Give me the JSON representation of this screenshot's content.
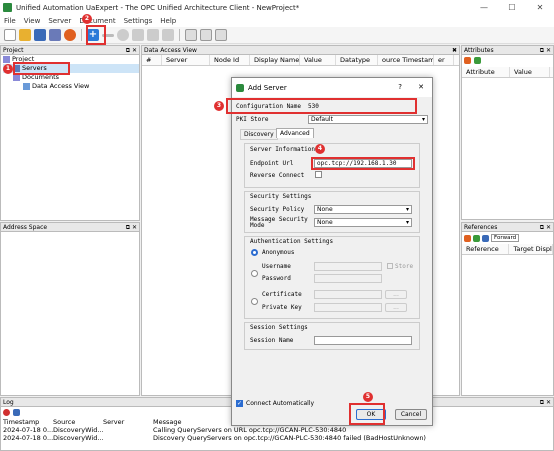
{
  "window": {
    "title": "Unified Automation UaExpert - The OPC Unified Architecture Client - NewProject*",
    "min": "—",
    "max": "☐",
    "close": "✕"
  },
  "menu": [
    "File",
    "View",
    "Server",
    "Document",
    "Settings",
    "Help"
  ],
  "project_panel": {
    "title": "Project",
    "items": [
      "Project",
      "Servers",
      "Documents",
      "Data Access View"
    ]
  },
  "address_panel": {
    "title": "Address Space"
  },
  "dav_panel": {
    "tab": "Data Access View",
    "columns": [
      "#",
      "Server",
      "Node Id",
      "Display Name",
      "Value",
      "Datatype",
      "ource Timestam",
      "er"
    ]
  },
  "attributes_panel": {
    "title": "Attributes",
    "columns": [
      "Attribute",
      "Value"
    ]
  },
  "references_panel": {
    "title": "References",
    "direction": "Forward",
    "columns": [
      "Reference",
      "Target Displa"
    ]
  },
  "log_panel": {
    "title": "Log",
    "columns": [
      "Timestamp",
      "Source",
      "Server",
      "Message"
    ],
    "rows": [
      {
        "ts": "2024-07-18 0...",
        "src": "DiscoveryWid...",
        "srv": "",
        "msg": "Calling QueryServers on URL opc.tcp://GCAN-PLC-530:4840"
      },
      {
        "ts": "2024-07-18 0...",
        "src": "DiscoveryWid...",
        "srv": "",
        "msg": "Discovery QueryServers on opc.tcp://GCAN-PLC-530:4840 failed (BadHostUnknown)"
      }
    ]
  },
  "dialog": {
    "title": "Add Server",
    "help": "?",
    "close": "✕",
    "config_name_label": "Configuration Name",
    "config_name_value": "530",
    "pki_label": "PKI Store",
    "pki_value": "Default",
    "tabs": [
      "Discovery",
      "Advanced"
    ],
    "server_info": "Server Information",
    "endpoint_label": "Endpoint Url",
    "endpoint_value": "opc.tcp://192.168.1.30",
    "reverse_label": "Reverse Connect",
    "security_settings": "Security Settings",
    "policy_label": "Security Policy",
    "policy_value": "None",
    "mode_label": "Message Security Mode",
    "mode_value": "None",
    "auth_settings": "Authentication Settings",
    "anon_label": "Anonymous",
    "user_label": "Username",
    "pass_label": "Password",
    "store_label": "Store",
    "cert_label": "Certificate",
    "key_label": "Private Key",
    "session_settings": "Session Settings",
    "session_label": "Session Name",
    "connect_auto": "Connect Automatically",
    "ok": "OK",
    "cancel": "Cancel"
  },
  "annotations": [
    "1",
    "2",
    "3",
    "4",
    "5"
  ]
}
